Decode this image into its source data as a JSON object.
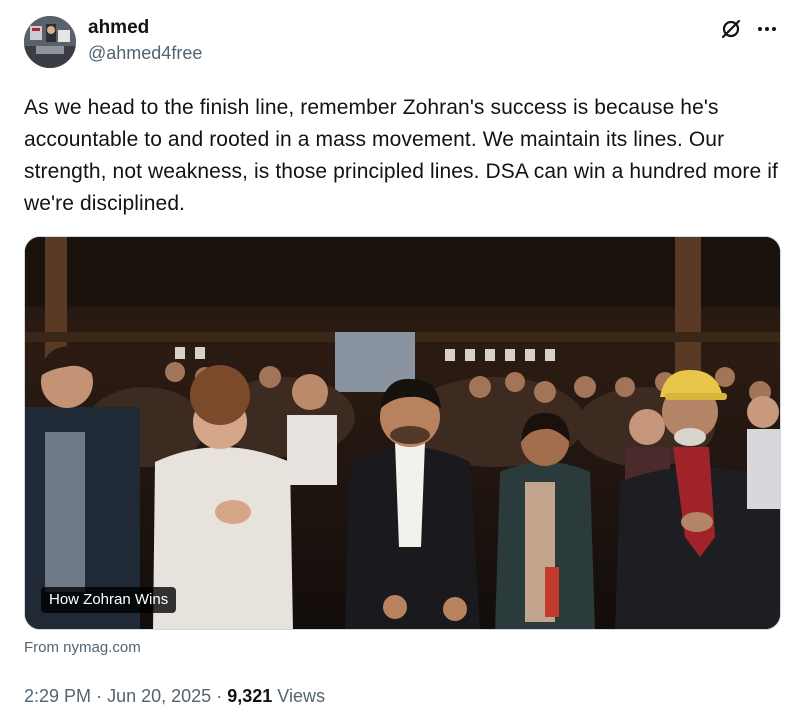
{
  "author": {
    "display_name": "ahmed",
    "handle": "@ahmed4free"
  },
  "top_actions": {
    "icons": [
      "grok-icon",
      "more-icon"
    ]
  },
  "tweet": {
    "text": "As we head to the finish line, remember Zohran's success is because he's accountable to and rooted in a mass movement. We maintain its lines. Our strength, not weakness, is those principled lines. DSA can win a hundred more if we're disciplined."
  },
  "media": {
    "caption": "How Zohran Wins"
  },
  "card": {
    "source": "From nymag.com"
  },
  "meta": {
    "time": "2:29 PM",
    "separator": "·",
    "date": "Jun 20, 2025",
    "views_count": "9,321",
    "views_label": "Views"
  }
}
